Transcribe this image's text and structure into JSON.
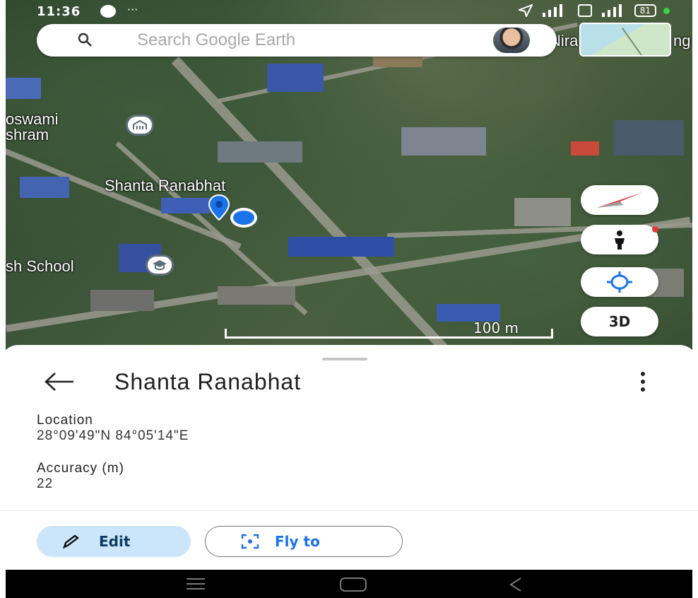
{
  "status_bar": {
    "time": "11:36",
    "more": "···",
    "battery": "81"
  },
  "search": {
    "placeholder": "Search Google Earth"
  },
  "map": {
    "labels": {
      "goswami_1": "oswami",
      "goswami_2": "shram",
      "place": "Shanta Ranabhat",
      "school": "sh School",
      "nira": "Nira",
      "ng": "ng"
    },
    "scale_label": "100 m",
    "controls": {
      "three_d": "3D"
    },
    "colors": {
      "pin": "#1a73e8",
      "road": "#9a9a8e"
    }
  },
  "sheet": {
    "title": "Shanta Ranabhat",
    "location_label": "Location",
    "location_value": "28°09'49\"N 84°05'14\"E",
    "accuracy_label": "Accuracy (m)",
    "accuracy_value": "22",
    "edit_label": "Edit",
    "fly_label": "Fly to"
  },
  "colors": {
    "edit_bg": "#cbe6fb",
    "fly_text": "#1a73e8"
  }
}
